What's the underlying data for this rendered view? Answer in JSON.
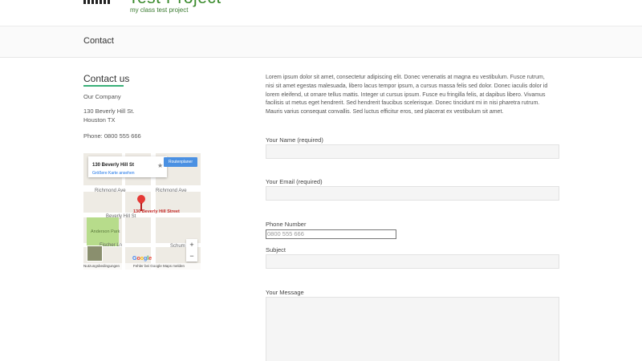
{
  "site": {
    "title": "Test Project",
    "tagline": "my class test project"
  },
  "page": {
    "title": "Contact"
  },
  "sidebar": {
    "heading": "Contact us",
    "company": "Our Company",
    "address_line1": "130 Beverly Hill St.",
    "address_line2": "Houston TX",
    "phone": "Phone: 0800 555 666"
  },
  "map": {
    "card_title": "130 Beverly Hill St",
    "card_link": "Größere Karte ansehen",
    "route_button": "Routenplaner",
    "star_icon": "star-icon",
    "street_top": "Richmond Ave",
    "street_top_right": "Richmond Ave",
    "street_mid": "Beverly Hill St",
    "pin_label": "130 Beverly Hill Street",
    "park_label": "Anderson Park",
    "street_bottom_left": "Fischer Ln",
    "street_bottom_right": "Schum",
    "zoom_in": "+",
    "zoom_out": "−",
    "google": "Google",
    "footer_left": "Nutzungsbedingungen",
    "footer_right": "Fehler bei Google Maps melden",
    "footer_extra": "©2018",
    "pin_color": "#e53935",
    "park_color": "#b7dc8b"
  },
  "main": {
    "intro": "Lorem ipsum dolor sit amet, consectetur adipiscing elit. Donec venenatis at magna eu vestibulum. Fusce rutrum, nisi sit amet egestas malesuada, libero lacus tempor ipsum, a cursus massa felis sed dolor. Donec iaculis dolor id lorem eleifend, ut ornare tellus mattis. Integer ut cursus ipsum. Fusce eu fringilla felis, at dapibus libero. Vivamus facilisis ut metus eget hendrerit. Sed hendrerit faucibus scelerisque. Donec tincidunt mi in nisi pharetra rutrum. Mauris varius consequat convallis. Sed luctus efficitur eros, sed placerat ex vestibulum sit amet.",
    "form": {
      "name_label": "Your Name (required)",
      "email_label": "Your Email (required)",
      "phone_label": "Phone Number",
      "phone_placeholder": "0800 555 666",
      "subject_label": "Subject",
      "message_label": "Your Message"
    }
  },
  "colors": {
    "accent": "#3ab078",
    "brand": "#3a8a2c"
  }
}
